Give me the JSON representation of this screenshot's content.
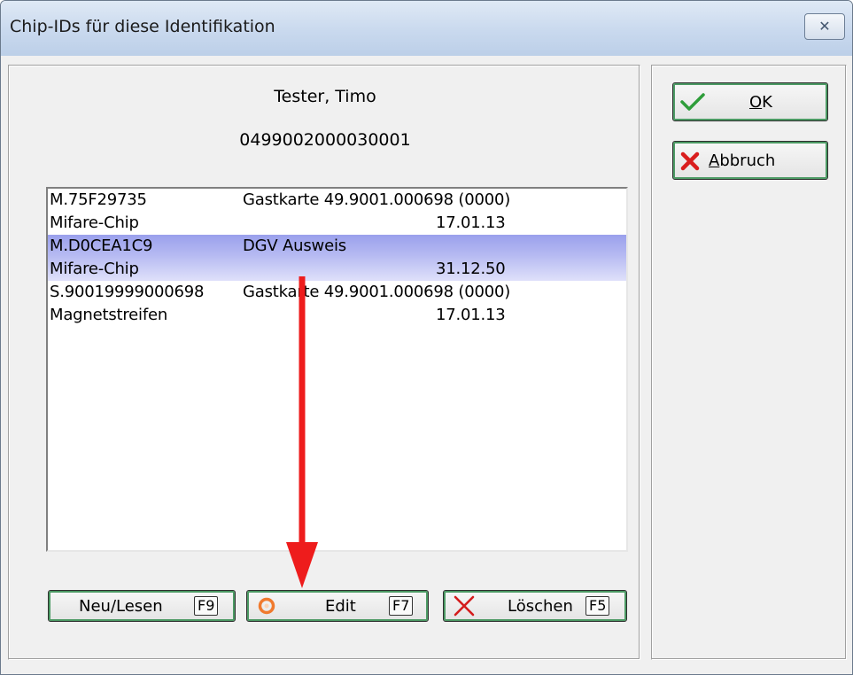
{
  "window": {
    "title": "Chip-IDs für diese Identifikation",
    "close_glyph": "✕"
  },
  "person": {
    "name": "Tester, Timo",
    "number": "0499002000030001"
  },
  "chip_list": [
    {
      "id": "M.75F29735",
      "description": "Gastkarte 49.9001.000698 (0000)",
      "type": "Mifare-Chip",
      "date": "17.01.13",
      "selected": false
    },
    {
      "id": "M.D0CEA1C9",
      "description": "DGV Ausweis",
      "type": "Mifare-Chip",
      "date": "31.12.50",
      "selected": true
    },
    {
      "id": "S.90019999000698",
      "description": "Gastkarte 49.9001.000698 (0000)",
      "type": "Magnetstreifen",
      "date": "17.01.13",
      "selected": false
    }
  ],
  "buttons": {
    "neu": {
      "label": "Neu/Lesen",
      "fkey": "F9"
    },
    "edit": {
      "label": "Edit",
      "fkey": "F7",
      "icon": "circle-icon"
    },
    "loeschen": {
      "label": "Löschen",
      "fkey": "F5",
      "icon": "x-icon"
    },
    "ok": {
      "label_mnemonic": "O",
      "label_rest": "K",
      "icon": "checkmark-icon"
    },
    "abbruch": {
      "label_mnemonic": "A",
      "label_rest": "bbruch",
      "icon": "x-icon"
    }
  },
  "colors": {
    "selection": "#b6baf2",
    "annotation_arrow": "#ee1c1c",
    "button_focus": "#4c9a64"
  }
}
